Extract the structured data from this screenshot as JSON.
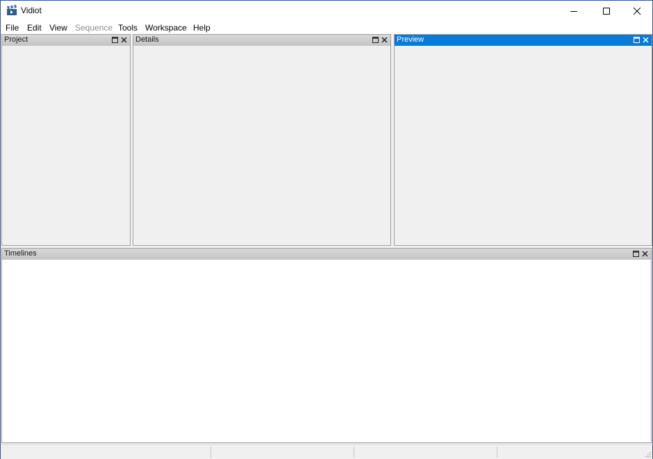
{
  "window": {
    "title": "Vidiot",
    "icon": "clapperboard-icon",
    "controls": {
      "minimize": "minimize-icon",
      "maximize": "maximize-icon",
      "close": "close-icon"
    }
  },
  "menubar": {
    "items": [
      {
        "label": "File",
        "enabled": true
      },
      {
        "label": "Edit",
        "enabled": true
      },
      {
        "label": "View",
        "enabled": true
      },
      {
        "label": "Sequence",
        "enabled": false
      },
      {
        "label": "Tools",
        "enabled": true
      },
      {
        "label": "Workspace",
        "enabled": true
      },
      {
        "label": "Help",
        "enabled": true
      }
    ]
  },
  "panels": {
    "project": {
      "title": "Project",
      "active": false
    },
    "details": {
      "title": "Details",
      "active": false
    },
    "preview": {
      "title": "Preview",
      "active": true
    },
    "timelines": {
      "title": "Timelines",
      "active": false
    }
  },
  "colors": {
    "active_header": "#0a7ad7",
    "inactive_header": "#cdcdcd",
    "window_border": "#2b579a"
  },
  "statusbar": {
    "fields": [
      "",
      "",
      "",
      ""
    ]
  }
}
